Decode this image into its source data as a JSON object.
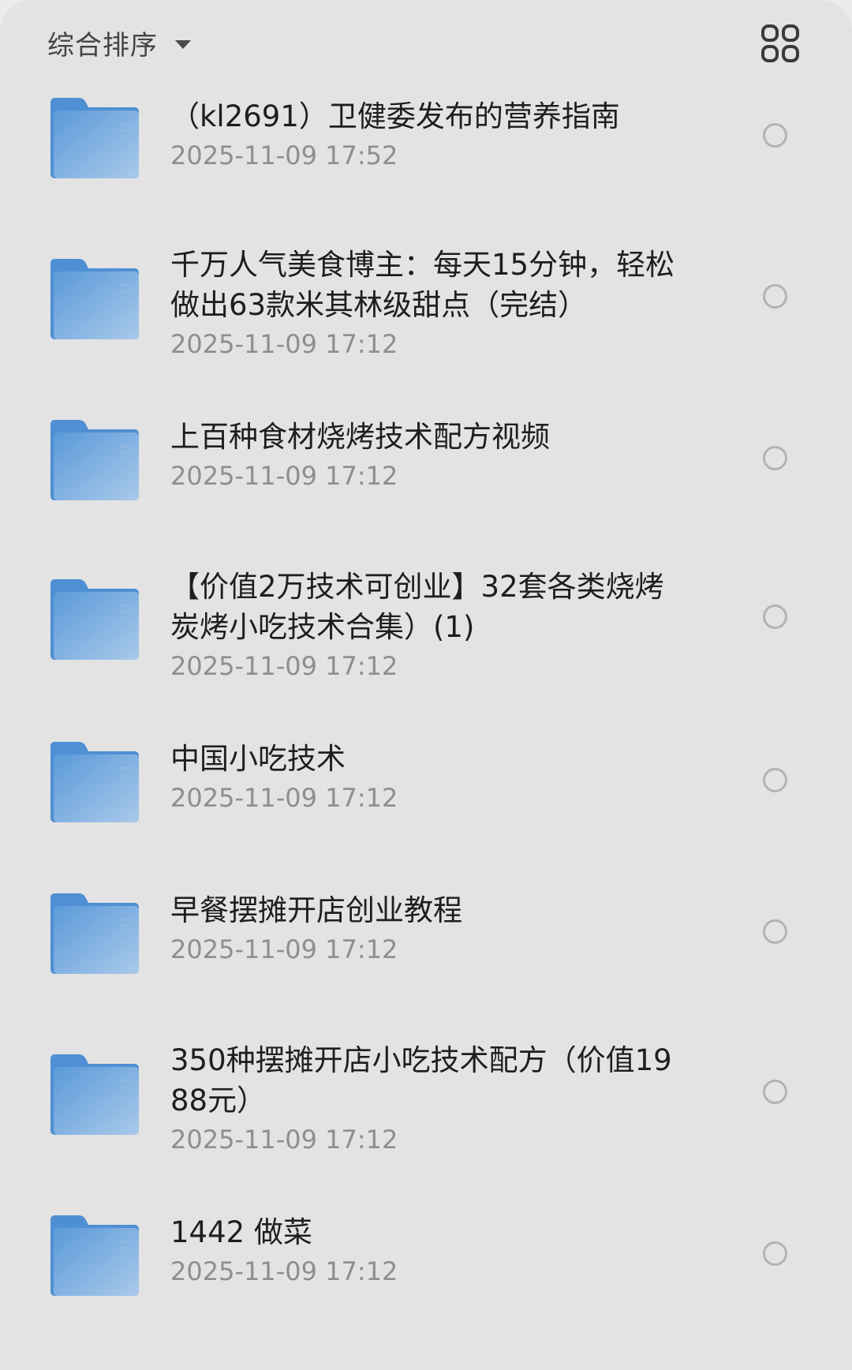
{
  "header": {
    "sort_label": "综合排序",
    "sort_icon": "caret-down-icon",
    "view_toggle_icon": "grid-view-icon"
  },
  "colors": {
    "folder_blue": "#5b9ad9",
    "folder_blue_light": "#a9c9ea",
    "background": "#e3e3e3",
    "title_text": "#1e1e1e",
    "time_text": "#8e8e8e"
  },
  "files": [
    {
      "name": "（kl2691）卫健委发布的营养指南",
      "time": "2025-11-09 17:52",
      "icon": "folder-icon"
    },
    {
      "name": "千万人气美食博主：每天15分钟，轻松做出63款米其林级甜点（完结）",
      "time": "2025-11-09 17:12",
      "icon": "folder-icon"
    },
    {
      "name": "上百种食材烧烤技术配方视频",
      "time": "2025-11-09 17:12",
      "icon": "folder-icon"
    },
    {
      "name": "【价值2万技术可创业】32套各类烧烤炭烤小吃技术合集）(1)",
      "time": "2025-11-09 17:12",
      "icon": "folder-icon"
    },
    {
      "name": "中国小吃技术",
      "time": "2025-11-09 17:12",
      "icon": "folder-icon"
    },
    {
      "name": "早餐摆摊开店创业教程",
      "time": "2025-11-09 17:12",
      "icon": "folder-icon"
    },
    {
      "name": "350种摆摊开店小吃技术配方（价值1988元）",
      "time": "2025-11-09 17:12",
      "icon": "folder-icon"
    },
    {
      "name": "1442 做菜",
      "time": "2025-11-09 17:12",
      "icon": "folder-icon"
    }
  ]
}
